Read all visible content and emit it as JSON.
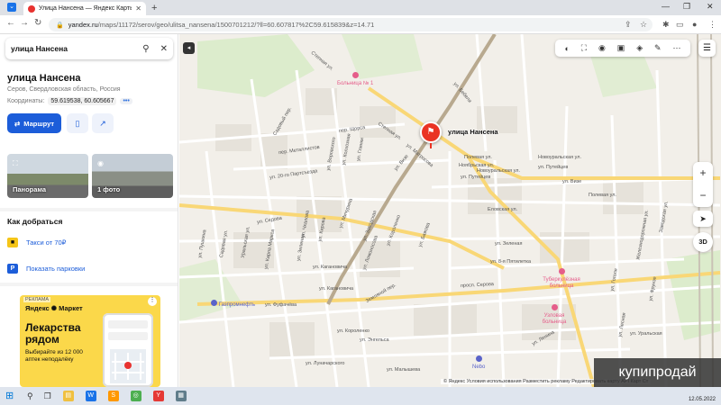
{
  "browser": {
    "tab_title": "Улица Нансена — Яндекс Карты",
    "tab_close": "✕",
    "new_tab": "+",
    "url_host": "yandex.ru",
    "url_path": "/maps/11172/serov/geo/ulitsa_nansena/1500701212/?ll=60.607817%2C59.615839&z=14.71",
    "window_controls": [
      "—",
      "❐",
      "✕"
    ]
  },
  "search": {
    "query": "улица Нансена"
  },
  "place": {
    "title": "улица Нансена",
    "subtitle": "Серов, Свердловская область, Россия",
    "coords_label": "Координаты:",
    "coords_value": "59.619538, 60.605667",
    "coords_more": "•••",
    "route_button": "Маршрут",
    "photos": [
      {
        "label": "Панорама"
      },
      {
        "label": "1 фото"
      }
    ],
    "howto_title": "Как добраться",
    "options": [
      {
        "label": "Такси от 70₽",
        "icon": "taxi-icon",
        "color": "#f5c518"
      },
      {
        "label": "Показать парковки",
        "icon": "parking-icon",
        "color": "#1c5dd9"
      }
    ]
  },
  "ad": {
    "tag": "РЕКЛАМА",
    "brand": "Яндекс ✺ Маркет",
    "headline": "Лекарства рядом",
    "text": "Выбирайте из 12 000 аптек неподалёку",
    "menu": "⋮"
  },
  "map": {
    "pin_label": "улица Нансена",
    "streets": [
      "Степная ул.",
      "ул. Бебеля",
      "пер. Щорса",
      "Садовый пер.",
      "пер. Металлистов",
      "ул. 20-го Партсъезда",
      "Степная ул.",
      "ул. Воровского",
      "ул. Глинки",
      "ул. Колхозная",
      "ул. Матросова",
      "ул. Визе",
      "Полевая ул.",
      "Ноябрьская ул.",
      "Новоуральская ул.",
      "ул. Путейцев",
      "Новоуральская ул.",
      "ул. Путейцев",
      "ул. Визе",
      "Еловская ул.",
      "ул. Седова",
      "ул. Мичурина",
      "ул. Заводская",
      "ул. Короленко",
      "ул. Бажова",
      "ул. Чкалова",
      "ул. Кирова",
      "ул. Ломоносова",
      "ул. Кагановича",
      "ул. Зеленая",
      "Земляной пер.",
      "ул. 8-я Пятилетка",
      "просп. Серова",
      "ул. Фуфачёва",
      "ул. Короленко",
      "ул. Энгельса",
      "ул. Луначарского",
      "ул. Малышева",
      "ул. Ленина",
      "ул. Гоголя",
      "ул. Фрунзе",
      "ул. Лесная",
      "ул. Уральская",
      "ул. Пушкина",
      "Садовая ул.",
      "Уральская ул.",
      "ул. Карла Маркса",
      "Железнодорожная ул.",
      "Заводская ул.",
      "Полевая ул.",
      "ул. Кагановича",
      "ул. Зеленая"
    ],
    "pois": [
      {
        "label": "Больница № 1",
        "kind": "hospital"
      },
      {
        "label": "Туберкулёзная больница",
        "kind": "hospital"
      },
      {
        "label": "Узловая больница",
        "kind": "hospital"
      },
      {
        "label": "Газпромнефть",
        "kind": "fuel"
      },
      {
        "label": "Nebo",
        "kind": "mall"
      }
    ],
    "attribution": "© Яндекс   Условия использования   Разместить рекламу   Редактировать карту   API Карт   Ст",
    "view_3d": "3D",
    "zoom_in": "+",
    "zoom_out": "−"
  },
  "watermark": "купипродай",
  "taskbar": {
    "time": "",
    "date": "12.05.2022"
  },
  "colors": {
    "accent": "#1c5dd9",
    "pin": "#ea3323",
    "map_bg": "#f2efe9",
    "ad_bg": "#fbd84a"
  }
}
